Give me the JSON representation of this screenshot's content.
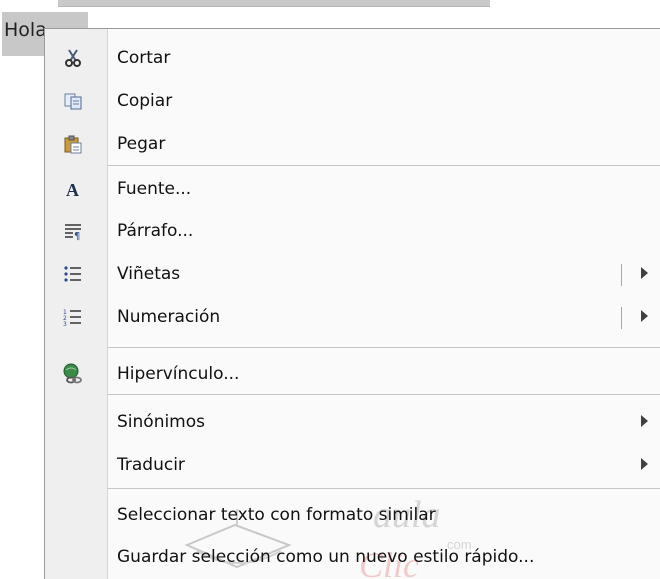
{
  "document": {
    "text": "Hola"
  },
  "menu": {
    "items": [
      {
        "label": "Cortar",
        "icon": "scissors-icon"
      },
      {
        "label": "Copiar",
        "icon": "copy-icon"
      },
      {
        "label": "Pegar",
        "icon": "paste-icon"
      },
      {
        "label": "Fuente...",
        "icon": "font-icon"
      },
      {
        "label": "Párrafo...",
        "icon": "paragraph-icon"
      },
      {
        "label": "Viñetas",
        "icon": "bullets-icon",
        "submenu": true
      },
      {
        "label": "Numeración",
        "icon": "numbering-icon",
        "submenu": true
      },
      {
        "label": "Hipervínculo...",
        "icon": "hyperlink-icon"
      },
      {
        "label": "Sinónimos",
        "submenu": true
      },
      {
        "label": "Traducir",
        "submenu": true
      },
      {
        "label": "Seleccionar texto con formato similar"
      },
      {
        "label": "Guardar selección como un nuevo estilo rápido..."
      }
    ]
  },
  "watermark": {
    "brand": "aula",
    "brand2": "Clic",
    "suffix": "com"
  }
}
